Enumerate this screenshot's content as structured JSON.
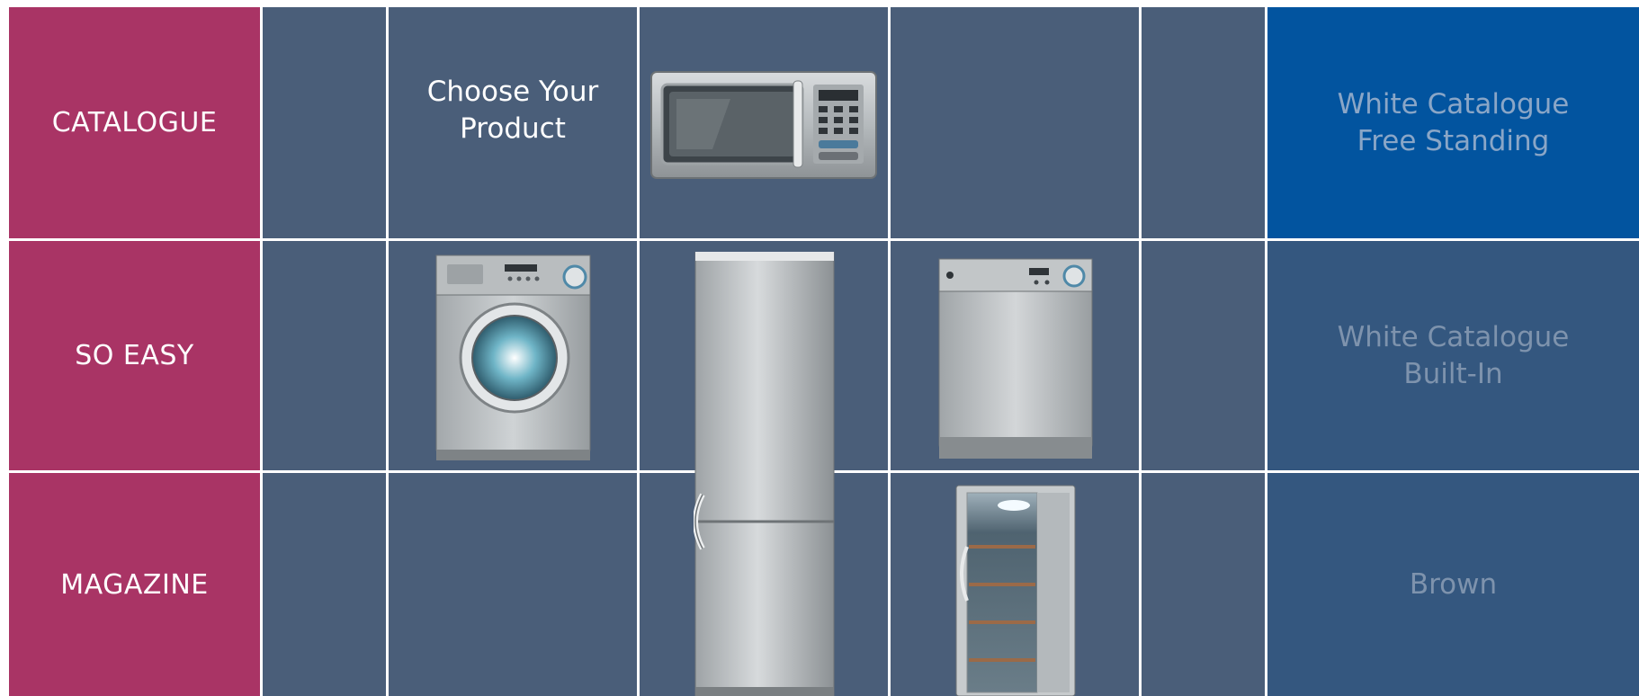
{
  "nav": {
    "catalogue": "CATALOGUE",
    "so_easy": "SO EASY",
    "magazine": "MAGAZINE"
  },
  "heading": {
    "line1": "Choose Your",
    "line2": "Product"
  },
  "catalogues": [
    {
      "line1": "White Catalogue",
      "line2": "Free Standing",
      "active": true
    },
    {
      "line1": "White Catalogue",
      "line2": "Built-In",
      "active": false
    },
    {
      "line1": "Brown",
      "line2": "",
      "active": false
    }
  ],
  "products": [
    "microwave",
    "washing-machine",
    "fridge-freezer",
    "dishwasher",
    "wine-cooler"
  ],
  "colors": {
    "nav_bg": "#a93465",
    "cell_bg": "#4a5e79",
    "active_catalogue_bg": "#02549f",
    "catalogue_bg": "#34577f",
    "grid_lines": "#ffffff"
  }
}
